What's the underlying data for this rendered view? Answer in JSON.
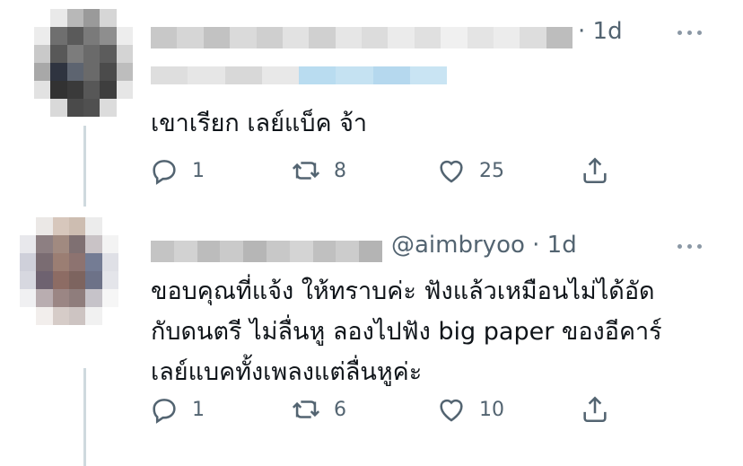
{
  "tweets": [
    {
      "meta": "· 1d",
      "text": "เขาเรียก เลย์แบ็ค จ้า",
      "replies": "1",
      "retweets": "8",
      "likes": "25"
    },
    {
      "handle": "@aimbryoo",
      "meta": "@aimbryoo · 1d",
      "text": "ขอบคุณที่แจ้ง ให้ทราบค่ะ ฟังแล้วเหมือนไม่ได้อัด\nกับดนตรี ไม่ลื่นหู ลองไปฟัง big paper ของอีคาร์\nเลย์แบคทั้งเพลงแต่ลื่นหูค่ะ",
      "replies": "1",
      "retweets": "6",
      "likes": "10"
    }
  ],
  "icons": {
    "reply": "reply-icon",
    "retweet": "retweet-icon",
    "like": "heart-icon",
    "share": "share-icon",
    "more": "more-icon"
  },
  "colors": {
    "muted": "#536471",
    "text": "#0f1419",
    "thread_line": "#cfd9de",
    "link_blur": "#b9dcf0"
  }
}
